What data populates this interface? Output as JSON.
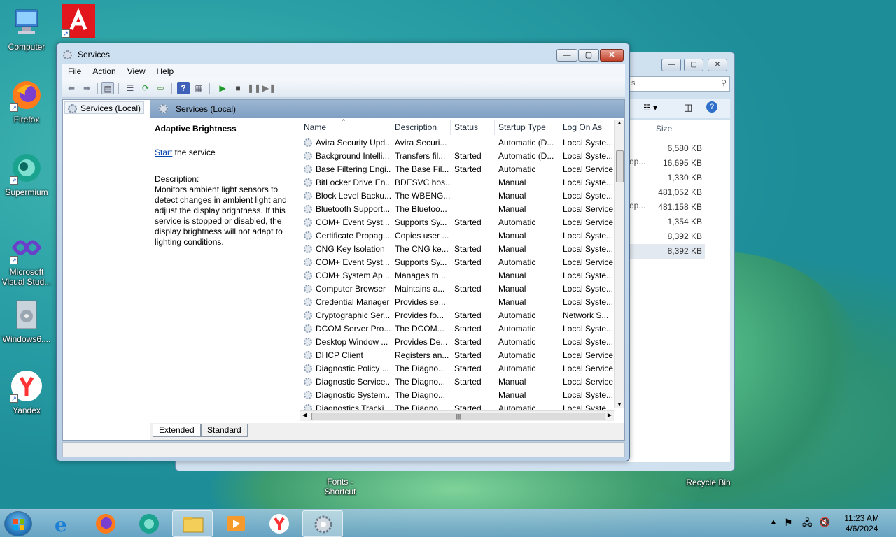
{
  "desktop": {
    "icons": [
      {
        "label": "Computer"
      },
      {
        "label": ""
      },
      {
        "label": "Firefox"
      },
      {
        "label": "Supermium"
      },
      {
        "label": "Microsoft Visual Stud..."
      },
      {
        "label": "Windows6...."
      },
      {
        "label": "Yandex"
      },
      {
        "label": "Fonts - Shortcut"
      },
      {
        "label": "Recycle Bin"
      }
    ]
  },
  "explorer": {
    "search_placeholder": "s",
    "size_header": "Size",
    "sizes": [
      "6,580 KB",
      "16,695 KB",
      "1,330 KB",
      "481,052 KB",
      "481,158 KB",
      "1,354 KB",
      "8,392 KB",
      "8,392 KB"
    ],
    "partial_texts": [
      "op...",
      "op..."
    ]
  },
  "services_window": {
    "title": "Services",
    "menu": [
      "File",
      "Action",
      "View",
      "Help"
    ],
    "tree_item": "Services (Local)",
    "pane_title": "Services (Local)",
    "detail": {
      "name": "Adaptive Brightness",
      "start_link": "Start",
      "start_suffix": " the service",
      "desc_label": "Description:",
      "desc_text": "Monitors ambient light sensors to detect changes in ambient light and adjust the display brightness.  If this service is stopped or disabled, the display brightness will not adapt to lighting conditions."
    },
    "columns": [
      "Name",
      "Description",
      "Status",
      "Startup Type",
      "Log On As"
    ],
    "rows": [
      [
        "Avira Security Upd...",
        "Avira Securi...",
        "",
        "Automatic (D...",
        "Local Syste..."
      ],
      [
        "Background Intelli...",
        "Transfers fil...",
        "Started",
        "Automatic (D...",
        "Local Syste..."
      ],
      [
        "Base Filtering Engi...",
        "The Base Fil...",
        "Started",
        "Automatic",
        "Local Service"
      ],
      [
        "BitLocker Drive En...",
        "BDESVC hos...",
        "",
        "Manual",
        "Local Syste..."
      ],
      [
        "Block Level Backu...",
        "The WBENG...",
        "",
        "Manual",
        "Local Syste..."
      ],
      [
        "Bluetooth Support...",
        "The Bluetoo...",
        "",
        "Manual",
        "Local Service"
      ],
      [
        "COM+ Event Syst...",
        "Supports Sy...",
        "Started",
        "Automatic",
        "Local Service"
      ],
      [
        "Certificate Propag...",
        "Copies user ...",
        "",
        "Manual",
        "Local Syste..."
      ],
      [
        "CNG Key Isolation",
        "The CNG ke...",
        "Started",
        "Manual",
        "Local Syste..."
      ],
      [
        "COM+ Event Syst...",
        "Supports Sy...",
        "Started",
        "Automatic",
        "Local Service"
      ],
      [
        "COM+ System Ap...",
        "Manages th...",
        "",
        "Manual",
        "Local Syste..."
      ],
      [
        "Computer Browser",
        "Maintains a...",
        "Started",
        "Manual",
        "Local Syste..."
      ],
      [
        "Credential Manager",
        "Provides se...",
        "",
        "Manual",
        "Local Syste..."
      ],
      [
        "Cryptographic Ser...",
        "Provides fo...",
        "Started",
        "Automatic",
        "Network S..."
      ],
      [
        "DCOM Server Pro...",
        "The DCOM...",
        "Started",
        "Automatic",
        "Local Syste..."
      ],
      [
        "Desktop Window ...",
        "Provides De...",
        "Started",
        "Automatic",
        "Local Syste..."
      ],
      [
        "DHCP Client",
        "Registers an...",
        "Started",
        "Automatic",
        "Local Service"
      ],
      [
        "Diagnostic Policy ...",
        "The Diagno...",
        "Started",
        "Automatic",
        "Local Service"
      ],
      [
        "Diagnostic Service...",
        "The Diagno...",
        "Started",
        "Manual",
        "Local Service"
      ],
      [
        "Diagnostic System...",
        "The Diagno...",
        "",
        "Manual",
        "Local Syste..."
      ],
      [
        "Diagnostics Tracki...",
        "The Diagno...",
        "Started",
        "Automatic",
        "Local Syste..."
      ]
    ],
    "tabs": [
      "Extended",
      "Standard"
    ]
  },
  "taskbar": {
    "time": "11:23 AM",
    "date": "4/6/2024"
  }
}
